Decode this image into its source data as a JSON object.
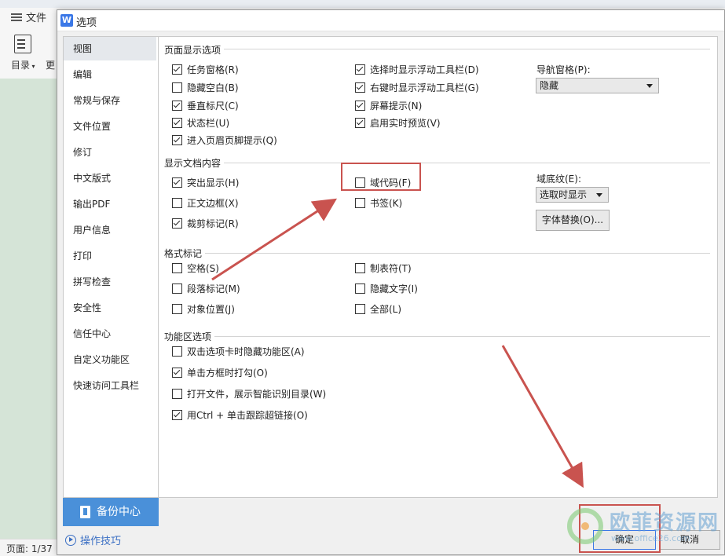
{
  "app": {
    "menu_label": "文件",
    "toc_label": "目录",
    "more_label": "更",
    "status_page": "页面: 1/37"
  },
  "dialog": {
    "title": "选项",
    "logo_letter": "W",
    "nav": [
      {
        "label": "视图",
        "selected": true
      },
      {
        "label": "编辑"
      },
      {
        "label": "常规与保存"
      },
      {
        "label": "文件位置"
      },
      {
        "label": "修订"
      },
      {
        "label": "中文版式"
      },
      {
        "label": "输出PDF"
      },
      {
        "label": "用户信息"
      },
      {
        "label": "打印"
      },
      {
        "label": "拼写检查"
      },
      {
        "label": "安全性"
      },
      {
        "label": "信任中心"
      },
      {
        "label": "自定义功能区"
      },
      {
        "label": "快速访问工具栏"
      }
    ],
    "backup_label": "备份中心",
    "tips_label": "操作技巧",
    "ok_label": "确定",
    "cancel_label": "取消"
  },
  "sections": {
    "page_display": {
      "title": "页面显示选项",
      "options": [
        {
          "label": "任务窗格(R)",
          "checked": true
        },
        {
          "label": "隐藏空白(B)",
          "checked": false
        },
        {
          "label": "垂直标尺(C)",
          "checked": true
        },
        {
          "label": "状态栏(U)",
          "checked": true
        },
        {
          "label": "进入页眉页脚提示(Q)",
          "checked": true
        },
        {
          "label": "选择时显示浮动工具栏(D)",
          "checked": true
        },
        {
          "label": "右键时显示浮动工具栏(G)",
          "checked": true
        },
        {
          "label": "屏幕提示(N)",
          "checked": true
        },
        {
          "label": "启用实时预览(V)",
          "checked": true
        }
      ],
      "nav_pane_label": "导航窗格(P):",
      "nav_pane_value": "隐藏"
    },
    "doc_content": {
      "title": "显示文档内容",
      "options": [
        {
          "label": "突出显示(H)",
          "checked": true
        },
        {
          "label": "正文边框(X)",
          "checked": false
        },
        {
          "label": "裁剪标记(R)",
          "checked": true
        },
        {
          "label": "域代码(F)",
          "checked": false
        },
        {
          "label": "书签(K)",
          "checked": false
        }
      ],
      "field_shading_label": "域底纹(E):",
      "field_shading_value": "选取时显示",
      "font_replace_label": "字体替换(O)..."
    },
    "format_marks": {
      "title": "格式标记",
      "options": [
        {
          "label": "空格(S)",
          "checked": false
        },
        {
          "label": "段落标记(M)",
          "checked": false
        },
        {
          "label": "对象位置(J)",
          "checked": false
        },
        {
          "label": "制表符(T)",
          "checked": false
        },
        {
          "label": "隐藏文字(I)",
          "checked": false
        },
        {
          "label": "全部(L)",
          "checked": false
        }
      ]
    },
    "ribbon": {
      "title": "功能区选项",
      "options": [
        {
          "label": "双击选项卡时隐藏功能区(A)",
          "checked": false
        },
        {
          "label": "单击方框时打勾(O)",
          "checked": true
        },
        {
          "label": "打开文件，展示智能识别目录(W)",
          "checked": false
        },
        {
          "label": "用Ctrl + 单击跟踪超链接(O)",
          "checked": true
        }
      ]
    }
  },
  "watermark": {
    "text": "欧菲资源网",
    "url": "www.office26.com"
  },
  "colors": {
    "accent": "#4a90d9",
    "annotation": "#c9534f",
    "link": "#3b6fc4"
  }
}
